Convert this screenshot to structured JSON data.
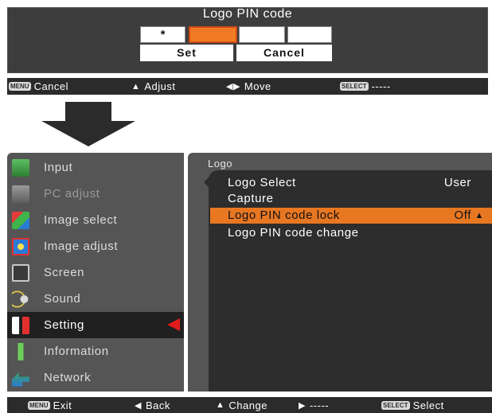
{
  "pin_dialog": {
    "title": "Logo PIN code",
    "digits": [
      "*",
      "",
      "",
      ""
    ],
    "set_label": "Set",
    "cancel_label": "Cancel"
  },
  "top_keybar": {
    "menu_tag": "MENU",
    "cancel": "Cancel",
    "adjust": "Adjust",
    "move": "Move",
    "select_tag": "SELECT",
    "select_value": "-----"
  },
  "sidebar": {
    "items": [
      {
        "label": "Input",
        "icon": "input-icon",
        "color": "#3fa84a"
      },
      {
        "label": "PC adjust",
        "icon": "pc-adjust-icon",
        "color": "#8a8a8a"
      },
      {
        "label": "Image select",
        "icon": "image-select-icon",
        "color": "#2b7bd6"
      },
      {
        "label": "Image adjust",
        "icon": "image-adjust-icon",
        "color": "#e23030"
      },
      {
        "label": "Screen",
        "icon": "screen-icon",
        "color": "#b8b8b8"
      },
      {
        "label": "Sound",
        "icon": "sound-icon",
        "color": "#d9c04a"
      },
      {
        "label": "Setting",
        "icon": "setting-icon",
        "color": "#ffffff"
      },
      {
        "label": "Information",
        "icon": "information-icon",
        "color": "#6bcf5a"
      },
      {
        "label": "Network",
        "icon": "network-icon",
        "color": "#e3c23a"
      }
    ],
    "selected": "Setting"
  },
  "panel": {
    "title": "Logo",
    "rows": [
      {
        "label": "Logo Select",
        "value": "User"
      },
      {
        "label": "Capture",
        "value": ""
      },
      {
        "label": "Logo PIN code lock",
        "value": "Off"
      },
      {
        "label": "Logo PIN code change",
        "value": ""
      }
    ],
    "highlighted": "Logo PIN code lock"
  },
  "bottom_keybar": {
    "menu_tag": "MENU",
    "exit": "Exit",
    "back": "Back",
    "change": "Change",
    "next": "-----",
    "select_tag": "SELECT",
    "select": "Select"
  },
  "colors": {
    "highlight": "#e87722",
    "pointer": "#e11b1b",
    "active_digit": "#f07b24"
  }
}
